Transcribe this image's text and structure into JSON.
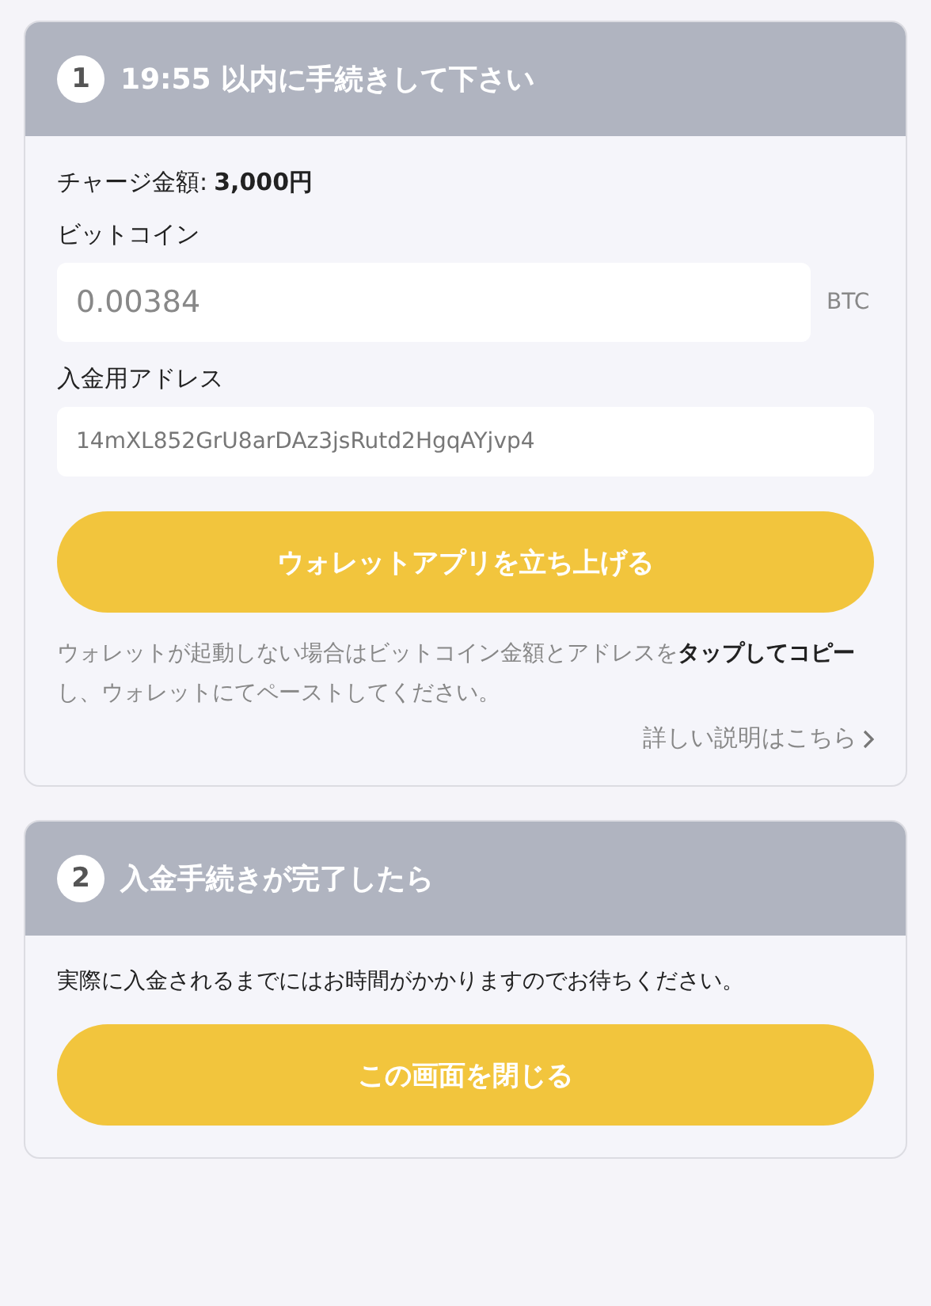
{
  "sections": [
    {
      "kind": "payment",
      "number": "1",
      "title": "19:55 以内に手続きして下さい",
      "charge_label": "チャージ金額:",
      "charge_amount": "3,000円",
      "bitcoin_label": "ビットコイン",
      "bitcoin_amount": "0.00384",
      "unit": "BTC",
      "address_label": "入金用アドレス",
      "address": "14mXL852GrU8arDAz3jsRutd2HgqAYjvp4",
      "button": "ウォレットアプリを立ち上げる",
      "note": "ウォレットが起動しない場合はビットコイン金額とアドレスを**タップしてコピー**し、ウォレットにてペーストしてください。",
      "link": "詳しい説明はこちら"
    },
    {
      "kind": "done",
      "number": "2",
      "title": "入金手続きが完了したら",
      "message": "実際に入金されるまでにはお時間がかかりますのでお待ちください。",
      "button": "この画面を閉じる"
    }
  ]
}
